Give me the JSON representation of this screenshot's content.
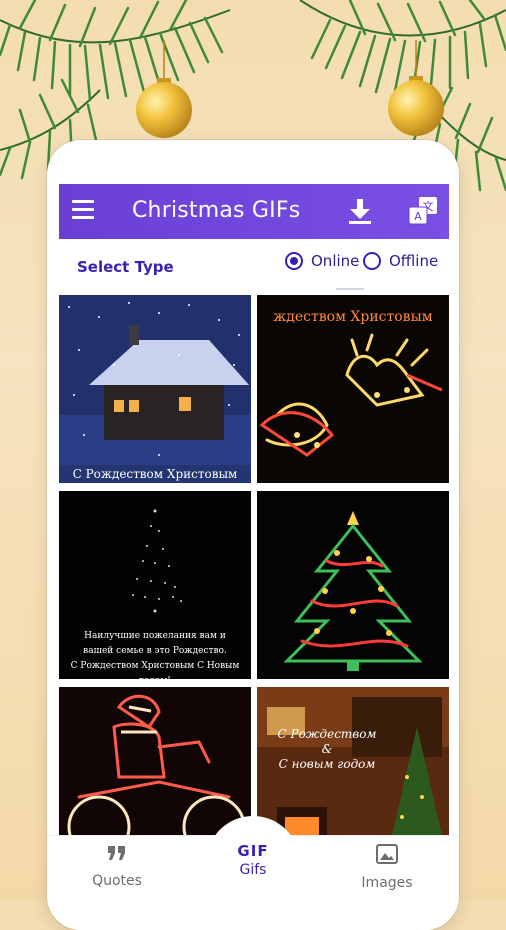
{
  "app": {
    "title": "Christmas GIFs"
  },
  "toolbar": {
    "menu_icon": "menu-icon",
    "download_icon": "download-icon",
    "translate_icon": "translate-icon"
  },
  "select": {
    "label": "Select Type",
    "options": [
      {
        "label": "Online",
        "selected": true
      },
      {
        "label": "Offline",
        "selected": false
      }
    ]
  },
  "grid": {
    "tiles": [
      {
        "caption": "С Рождеством Христовым"
      },
      {
        "headline": "ждеством Христовым"
      },
      {
        "lines": [
          "Наилучшие пожелания вам и",
          "вашей семье в это Рождество.",
          "С Рождеством Христовым С Новым годом!"
        ]
      },
      {},
      {},
      {
        "lines": [
          "С Рождеством",
          "&",
          "С новым годом"
        ]
      }
    ]
  },
  "nav": {
    "items": [
      {
        "label": "Quotes",
        "icon": "quote-icon"
      },
      {
        "label": "Gifs",
        "icon_text": "GIF"
      },
      {
        "label": "Images",
        "icon": "image-icon"
      }
    ]
  },
  "colors": {
    "accent": "#6a3fd6",
    "primary_text": "#3b1fb4",
    "background": "#f3ddb0"
  }
}
